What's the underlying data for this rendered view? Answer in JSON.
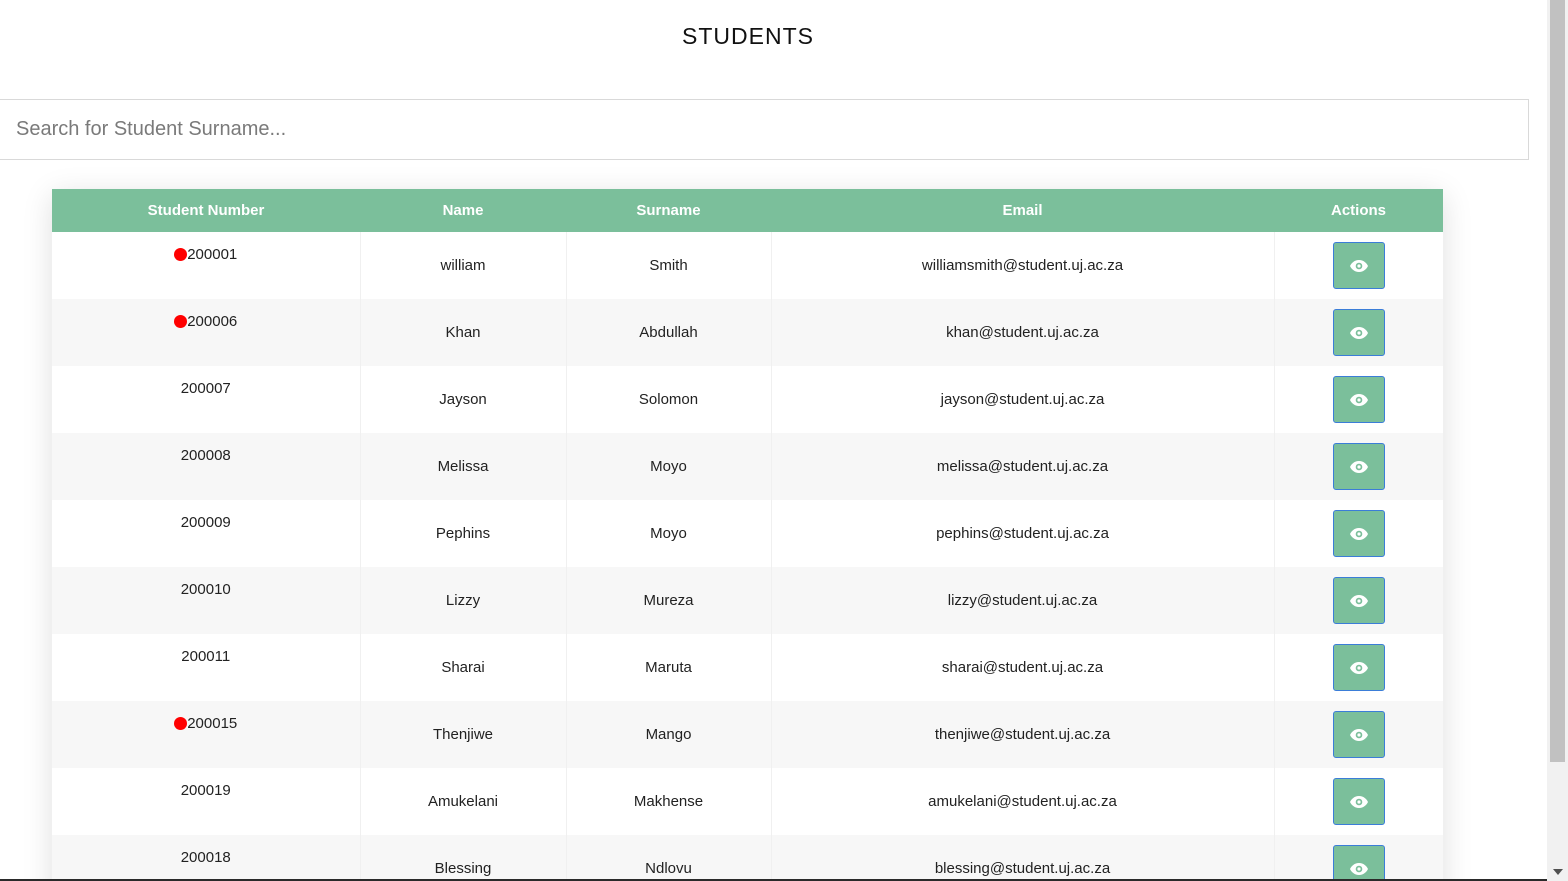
{
  "page": {
    "title": "STUDENTS"
  },
  "search": {
    "placeholder": "Search for Student Surname...",
    "value": ""
  },
  "table": {
    "headers": {
      "student_number": "Student Number",
      "name": "Name",
      "surname": "Surname",
      "email": "Email",
      "actions": "Actions"
    },
    "rows": [
      {
        "student_number": "200001",
        "flagged": true,
        "name": "william",
        "surname": "Smith",
        "email": "williamsmith@student.uj.ac.za"
      },
      {
        "student_number": "200006",
        "flagged": true,
        "name": "Khan",
        "surname": "Abdullah",
        "email": "khan@student.uj.ac.za"
      },
      {
        "student_number": "200007",
        "flagged": false,
        "name": "Jayson",
        "surname": "Solomon",
        "email": "jayson@student.uj.ac.za"
      },
      {
        "student_number": "200008",
        "flagged": false,
        "name": "Melissa",
        "surname": "Moyo",
        "email": "melissa@student.uj.ac.za"
      },
      {
        "student_number": "200009",
        "flagged": false,
        "name": "Pephins",
        "surname": "Moyo",
        "email": "pephins@student.uj.ac.za"
      },
      {
        "student_number": "200010",
        "flagged": false,
        "name": "Lizzy",
        "surname": "Mureza",
        "email": "lizzy@student.uj.ac.za"
      },
      {
        "student_number": "200011",
        "flagged": false,
        "name": "Sharai",
        "surname": "Maruta",
        "email": "sharai@student.uj.ac.za"
      },
      {
        "student_number": "200015",
        "flagged": true,
        "name": "Thenjiwe",
        "surname": "Mango",
        "email": "thenjiwe@student.uj.ac.za"
      },
      {
        "student_number": "200019",
        "flagged": false,
        "name": "Amukelani",
        "surname": "Makhense",
        "email": "amukelani@student.uj.ac.za"
      },
      {
        "student_number": "200018",
        "flagged": false,
        "name": "Blessing",
        "surname": "Ndlovu",
        "email": "blessing@student.uj.ac.za"
      }
    ],
    "action_icon": "eye-icon"
  },
  "colors": {
    "header_bg": "#7bbf9b",
    "button_bg": "#7bbf9b",
    "button_border": "#3b7dd8",
    "flag_dot": "#ff0000"
  }
}
